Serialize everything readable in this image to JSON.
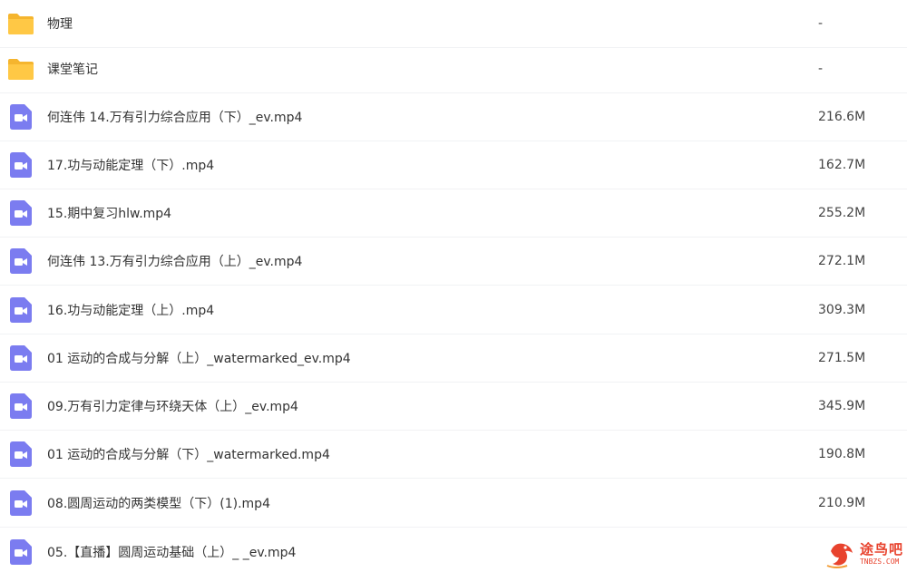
{
  "files": [
    {
      "type": "folder",
      "name": "物理",
      "size": "-"
    },
    {
      "type": "folder",
      "name": "课堂笔记",
      "size": "-"
    },
    {
      "type": "video",
      "name": "何连伟 14.万有引力综合应用（下）_ev.mp4",
      "size": "216.6M"
    },
    {
      "type": "video",
      "name": "17.功与动能定理（下）.mp4",
      "size": "162.7M"
    },
    {
      "type": "video",
      "name": "15.期中复习hlw.mp4",
      "size": "255.2M"
    },
    {
      "type": "video",
      "name": "何连伟 13.万有引力综合应用（上）_ev.mp4",
      "size": "272.1M"
    },
    {
      "type": "video",
      "name": "16.功与动能定理（上）.mp4",
      "size": "309.3M"
    },
    {
      "type": "video",
      "name": "01 运动的合成与分解（上）_watermarked_ev.mp4",
      "size": "271.5M"
    },
    {
      "type": "video",
      "name": "09.万有引力定律与环绕天体（上）_ev.mp4",
      "size": "345.9M"
    },
    {
      "type": "video",
      "name": "01 运动的合成与分解（下）_watermarked.mp4",
      "size": "190.8M"
    },
    {
      "type": "video",
      "name": "08.圆周运动的两类模型（下）(1).mp4",
      "size": "210.9M"
    },
    {
      "type": "video",
      "name": "05.【直播】圆周运动基础（上）_ _ev.mp4",
      "size": ""
    }
  ],
  "watermark": {
    "title": "途鸟吧",
    "subtitle": "TNBZS.COM"
  },
  "colors": {
    "folder": "#ffc845",
    "folder_tab": "#f5b52e",
    "video": "#7b7cf0",
    "watermark": "#e8432e"
  },
  "icons": {
    "folder": "folder-icon",
    "video": "video-file-icon"
  }
}
